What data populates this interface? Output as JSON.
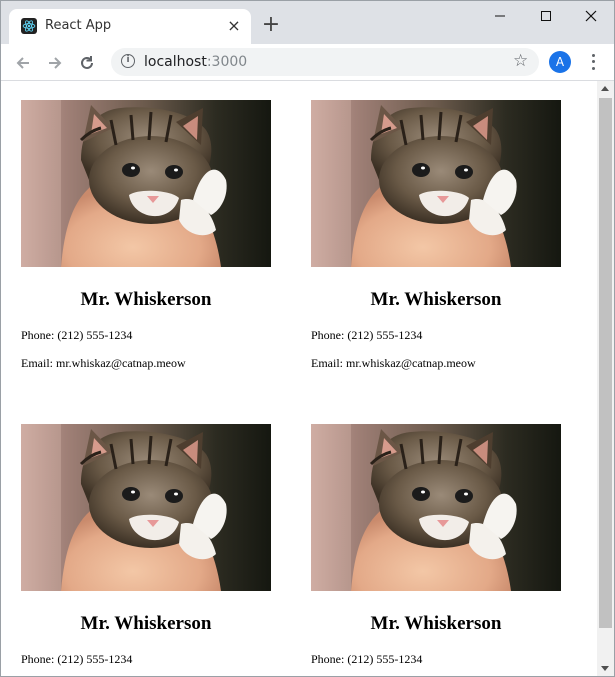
{
  "browser": {
    "tab_title": "React App",
    "url_host": "localhost",
    "url_port": ":3000",
    "avatar_letter": "A",
    "accent_color": "#1a73e8"
  },
  "contacts": [
    {
      "name": "Mr. Whiskerson",
      "phone": "Phone: (212) 555-1234",
      "email": "Email: mr.whiskaz@catnap.meow",
      "photo": "kitten-photo"
    },
    {
      "name": "Mr. Whiskerson",
      "phone": "Phone: (212) 555-1234",
      "email": "Email: mr.whiskaz@catnap.meow",
      "photo": "kitten-photo"
    },
    {
      "name": "Mr. Whiskerson",
      "phone": "Phone: (212) 555-1234",
      "email": "",
      "photo": "kitten-photo"
    },
    {
      "name": "Mr. Whiskerson",
      "phone": "Phone: (212) 555-1234",
      "email": "",
      "photo": "kitten-photo"
    }
  ]
}
